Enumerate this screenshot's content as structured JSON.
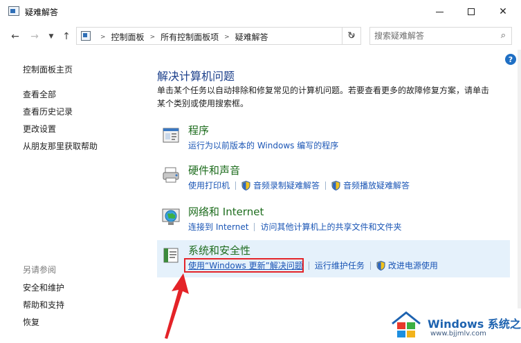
{
  "window": {
    "title": "疑难解答",
    "min_icon": "minimize-icon",
    "max_icon": "maximize-icon",
    "close_icon": "close-icon"
  },
  "nav": {
    "breadcrumbs": [
      "控制面板",
      "所有控制面板项",
      "疑难解答"
    ],
    "search_placeholder": "搜索疑难解答"
  },
  "sidebar": {
    "items": [
      {
        "label": "控制面板主页"
      },
      {
        "label": "查看全部"
      },
      {
        "label": "查看历史记录"
      },
      {
        "label": "更改设置"
      },
      {
        "label": "从朋友那里获取帮助"
      }
    ],
    "see_also_title": "另请参阅",
    "see_also": [
      {
        "label": "安全和维护"
      },
      {
        "label": "帮助和支持"
      },
      {
        "label": "恢复"
      }
    ]
  },
  "main": {
    "heading": "解决计算机问题",
    "description": "单击某个任务以自动排除和修复常见的计算机问题。若要查看更多的故障修复方案，请单击某个类别或使用搜索框。",
    "categories": [
      {
        "title": "程序",
        "links": [
          "运行为以前版本的 Windows 编写的程序"
        ]
      },
      {
        "title": "硬件和声音",
        "links": [
          "使用打印机",
          "音频录制疑难解答",
          "音频播放疑难解答"
        ]
      },
      {
        "title": "网络和 Internet",
        "links": [
          "连接到 Internet",
          "访问其他计算机上的共享文件和文件夹"
        ]
      },
      {
        "title": "系统和安全性",
        "links": [
          "使用“Windows 更新”解决问题",
          "运行维护任务",
          "改进电源使用"
        ]
      }
    ]
  },
  "watermark": {
    "brand": "Windows",
    "brand_cn": "系统之家",
    "url": "www.bjjmlv.com"
  },
  "colors": {
    "accent": "#1a55b5",
    "category_title": "#1d6c1d",
    "heading": "#1a3e8a",
    "selection": "#e5f1fb",
    "highlight": "#e42328"
  }
}
